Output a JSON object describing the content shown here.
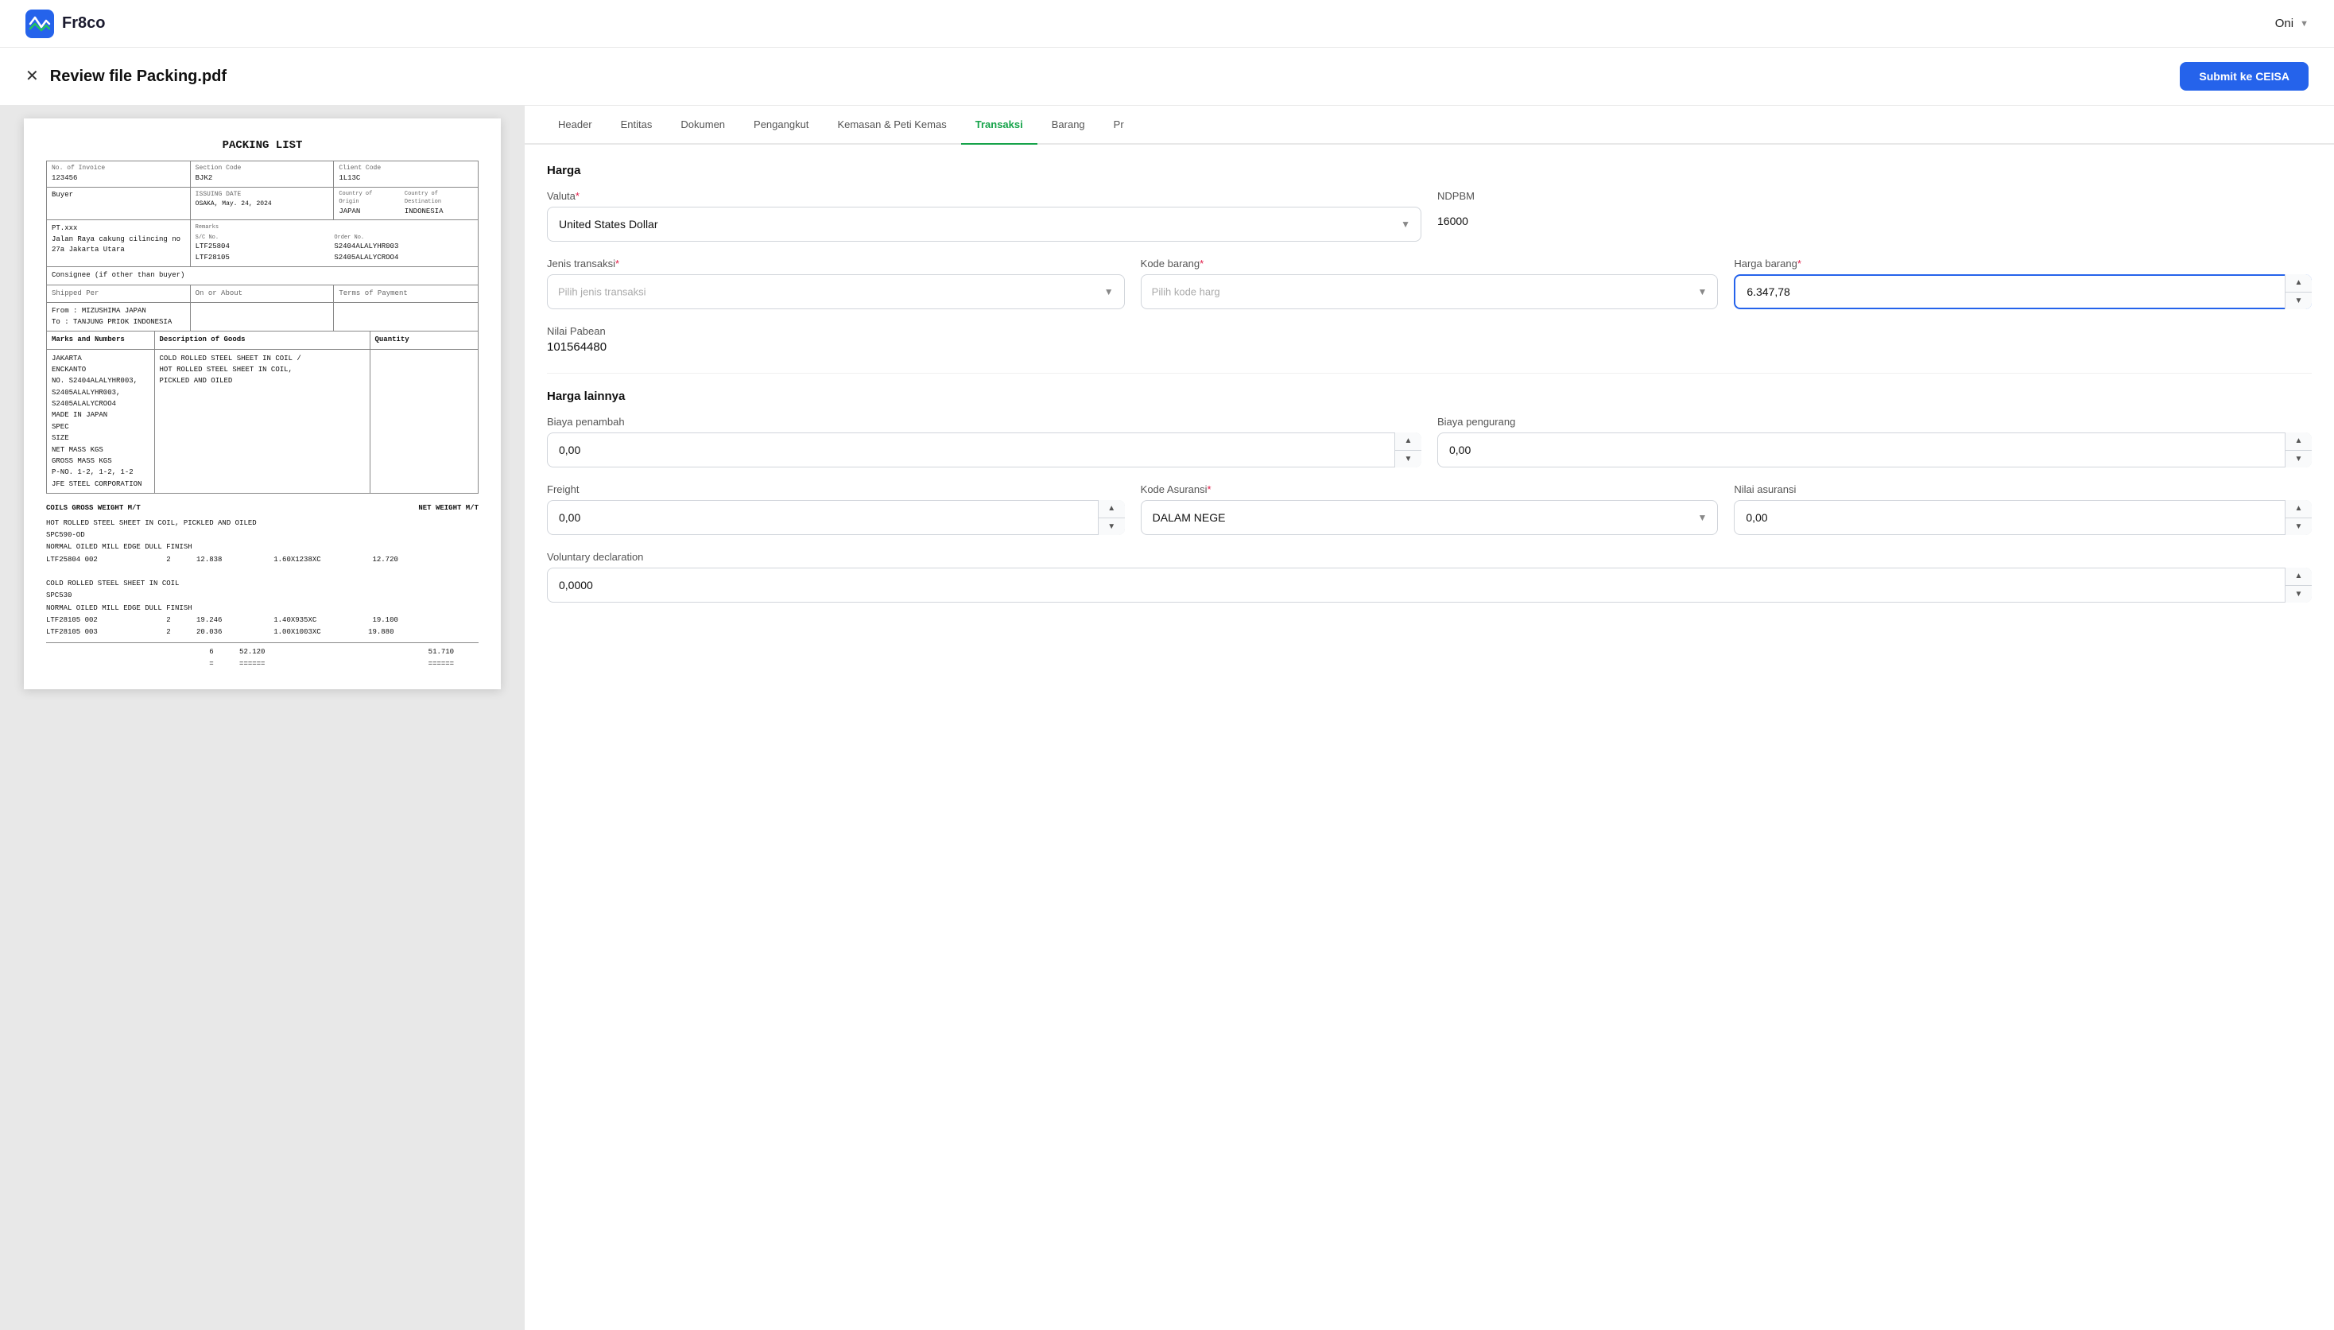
{
  "app": {
    "logo_text": "Fr8co",
    "user_name": "Oni"
  },
  "page": {
    "title": "Review file Packing.pdf",
    "submit_label": "Submit ke CEISA"
  },
  "tabs": [
    {
      "id": "header",
      "label": "Header",
      "active": false
    },
    {
      "id": "entitas",
      "label": "Entitas",
      "active": false
    },
    {
      "id": "dokumen",
      "label": "Dokumen",
      "active": false
    },
    {
      "id": "pengangkut",
      "label": "Pengangkut",
      "active": false
    },
    {
      "id": "kemasan",
      "label": "Kemasan & Peti Kemas",
      "active": false
    },
    {
      "id": "transaksi",
      "label": "Transaksi",
      "active": true
    },
    {
      "id": "barang",
      "label": "Barang",
      "active": false
    },
    {
      "id": "pr",
      "label": "Pr",
      "active": false
    }
  ],
  "form": {
    "harga_section_title": "Harga",
    "valuta_label": "Valuta",
    "valuta_value": "United States Dollar",
    "ndpbm_label": "NDPBM",
    "ndpbm_value": "16000",
    "jenis_transaksi_label": "Jenis transaksi",
    "jenis_transaksi_placeholder": "Pilih jenis transaksi",
    "kode_barang_label": "Kode barang",
    "kode_barang_placeholder": "Pilih kode harg",
    "harga_barang_label": "Harga barang",
    "harga_barang_value": "6.347,78",
    "nilai_pabean_label": "Nilai Pabean",
    "nilai_pabean_value": "101564480",
    "harga_lainnya_title": "Harga lainnya",
    "biaya_penambah_label": "Biaya penambah",
    "biaya_penambah_value": "0,00",
    "biaya_pengurang_label": "Biaya pengurang",
    "biaya_pengurang_value": "0,00",
    "freight_label": "Freight",
    "freight_value": "0,00",
    "kode_asuransi_label": "Kode Asuransi",
    "kode_asuransi_value": "DALAM NEGE",
    "nilai_asuransi_label": "Nilai asuransi",
    "nilai_asuransi_value": "0,00",
    "voluntary_declaration_label": "Voluntary declaration",
    "voluntary_declaration_value": "0,0000"
  },
  "doc": {
    "title": "PACKING LIST",
    "invoice_no_label": "No. of Invoice",
    "invoice_no": "123456",
    "section_code_label": "Section Code",
    "section_code": "BJK2",
    "issuing_date_label": "ISSUING DATE",
    "issuing_date": "OSAKA, May. 24, 2024",
    "client_code_label": "Client Code",
    "client_code": "1L13C",
    "buyer_label": "Buyer",
    "buyer_name": "PT.xxx",
    "buyer_address": "Jalan Raya cakung cilincing no 27a Jakarta Utara",
    "country_origin": "JAPAN",
    "country_dest": "INDONESIA",
    "consignee_label": "Consignee (if other than buyer)",
    "shipped_per_label": "Shipped Per",
    "on_or_about_label": "On or About",
    "terms_label": "Terms of Payment",
    "from_label": "From :",
    "from_value": "MIZUSHIMA JAPAN",
    "to_label": "To :",
    "to_value": "TANJUNG PRIOK INDONESIA",
    "marks_label": "Marks and Numbers",
    "description_label": "Description of Goods",
    "quantity_label": "Quantity",
    "marks_values": [
      "JAKARTA",
      "ENCKANTO",
      "NO. S2404ALALYHR003,",
      "S2405ALALYHR003,",
      "S2405ALALYCROO4",
      "MADE IN JAPAN",
      "SPEC",
      "SIZE",
      "NET MASS KGS",
      "GROSS MASS KGS",
      "P-NO. 1-2, 1-2, 1-2",
      "JFE STEEL CORPORATION"
    ],
    "description_values": [
      "COLD ROLLED STEEL SHEET IN COIL /",
      "HOT ROLLED STEEL SHEET IN COIL,",
      "PICKLED AND OILED"
    ],
    "coils_header": "COILS  GROSS WEIGHT M/T",
    "net_weight_header": "NET WEIGHT M/T",
    "rows": [
      {
        "label": "HOT ROLLED STEEL SHEET IN COIL, PICKLED AND OILED",
        "code": "SPC590",
        "sub": "NORMAL OILED MILL EDGE DULL FINISH",
        "ref": "LTF25804",
        "num": "2",
        "gross": "12.838",
        "dim": "1.60X1238XC",
        "net": "12.720"
      },
      {
        "label": "COLD ROLLED STEEL SHEET IN COIL",
        "code": "SPC530",
        "sub": "NORMAL OILED MILL EDGE DULL FINISH",
        "ref": "LTF28105 002",
        "num": "2",
        "gross": "19.246",
        "dim": "1.40X935XC",
        "net": "19.100"
      },
      {
        "ref": "LTF28105 003",
        "num": "2",
        "gross": "20.036",
        "dim": "1.00X1003XC",
        "net": "19.880"
      }
    ],
    "total_num": "6",
    "total_gross": "52.120",
    "total_net": "51.710"
  }
}
